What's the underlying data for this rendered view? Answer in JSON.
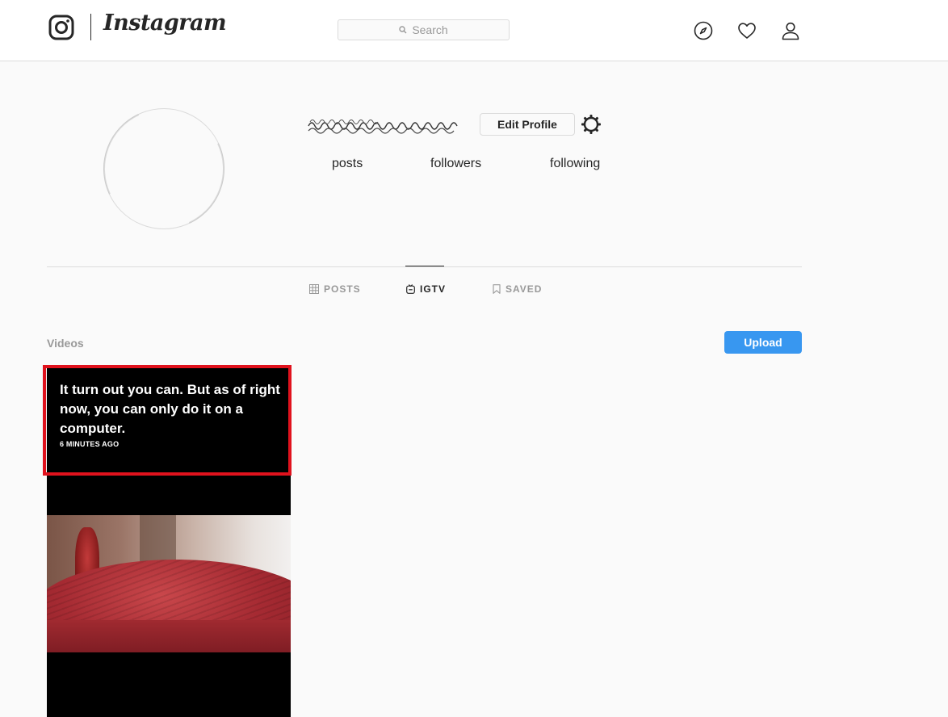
{
  "nav": {
    "brand": "Instagram",
    "search_placeholder": "Search"
  },
  "profile": {
    "username": "obscured",
    "edit_profile_label": "Edit Profile",
    "stats": {
      "posts_label": "posts",
      "followers_label": "followers",
      "following_label": "following"
    }
  },
  "tabs": [
    {
      "label": "POSTS",
      "icon": "grid-icon",
      "active": false
    },
    {
      "label": "IGTV",
      "icon": "igtv-icon",
      "active": true
    },
    {
      "label": "SAVED",
      "icon": "bookmark-icon",
      "active": false
    }
  ],
  "section": {
    "title": "Videos",
    "upload_label": "Upload"
  },
  "videos": [
    {
      "title": "It turn out you can. But as of right now, you can only do it on a computer.",
      "time": "6 MINUTES AGO"
    }
  ],
  "colors": {
    "accent": "#3897f0",
    "highlight_border": "#e0121d",
    "background": "#fafafa"
  }
}
